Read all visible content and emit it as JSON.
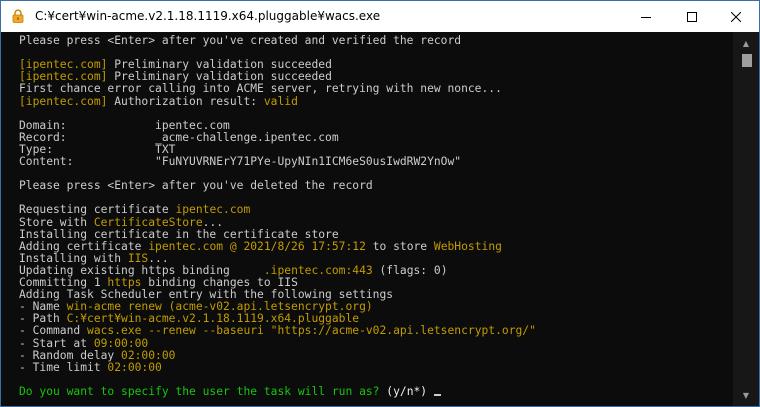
{
  "window": {
    "title": "C:¥cert¥win-acme.v2.1.18.1119.x64.pluggable¥wacs.exe",
    "icon": "lock-icon",
    "buttons": {
      "minimize": "minimize-icon",
      "maximize": "maximize-icon",
      "close": "close-icon"
    }
  },
  "colors": {
    "default": "#cccccc",
    "highlight": "#c19c00",
    "value": "#16c60c",
    "background": "#0c0c0c"
  },
  "console": {
    "lines": [
      [
        {
          "t": "Please press <Enter> after you've created and verified the record",
          "c": "def"
        }
      ],
      [],
      [
        {
          "t": "[ipentec.com]",
          "c": "yel"
        },
        {
          "t": " Preliminary validation succeeded",
          "c": "def"
        }
      ],
      [
        {
          "t": "[ipentec.com]",
          "c": "yel"
        },
        {
          "t": " Preliminary validation succeeded",
          "c": "def"
        }
      ],
      [
        {
          "t": "First chance error calling into ACME server, retrying with new nonce...",
          "c": "def"
        }
      ],
      [
        {
          "t": "[ipentec.com]",
          "c": "yel"
        },
        {
          "t": " Authorization result: ",
          "c": "def"
        },
        {
          "t": "valid",
          "c": "yel"
        }
      ],
      [],
      [
        {
          "t": "Domain:             ipentec.com",
          "c": "def"
        }
      ],
      [
        {
          "t": "Record:             _acme-challenge.ipentec.com",
          "c": "def"
        }
      ],
      [
        {
          "t": "Type:               TXT",
          "c": "def"
        }
      ],
      [
        {
          "t": "Content:            \"FuNYUVRNErY71PYe-UpyNIn1ICM6eS0usIwdRW2YnOw\"",
          "c": "def"
        }
      ],
      [],
      [
        {
          "t": "Please press <Enter> after you've deleted the record",
          "c": "def"
        }
      ],
      [],
      [
        {
          "t": "Requesting certificate ",
          "c": "def"
        },
        {
          "t": "ipentec.com",
          "c": "yel"
        }
      ],
      [
        {
          "t": "Store with ",
          "c": "def"
        },
        {
          "t": "CertificateStore",
          "c": "yel"
        },
        {
          "t": "...",
          "c": "def"
        }
      ],
      [
        {
          "t": "Installing certificate in the certificate store",
          "c": "def"
        }
      ],
      [
        {
          "t": "Adding certificate ",
          "c": "def"
        },
        {
          "t": "ipentec.com @ 2021/8/26 17:57:12",
          "c": "yel"
        },
        {
          "t": " to store ",
          "c": "def"
        },
        {
          "t": "WebHosting",
          "c": "yel"
        }
      ],
      [
        {
          "t": "Installing with ",
          "c": "def"
        },
        {
          "t": "IIS",
          "c": "yel"
        },
        {
          "t": "...",
          "c": "def"
        }
      ],
      [
        {
          "t": "Updating existing https binding     ",
          "c": "def"
        },
        {
          "t": ".ipentec.com:443",
          "c": "yel"
        },
        {
          "t": " (flags: 0)",
          "c": "def"
        }
      ],
      [
        {
          "t": "Committing 1 ",
          "c": "def"
        },
        {
          "t": "https",
          "c": "yel"
        },
        {
          "t": " binding changes to IIS",
          "c": "def"
        }
      ],
      [
        {
          "t": "Adding Task Scheduler entry with the following settings",
          "c": "def"
        }
      ],
      [
        {
          "t": "- Name ",
          "c": "def"
        },
        {
          "t": "win-acme renew (acme-v02.api.letsencrypt.org)",
          "c": "yel"
        }
      ],
      [
        {
          "t": "- Path ",
          "c": "def"
        },
        {
          "t": "C:¥cert¥win-acme.v2.1.18.1119.x64.pluggable",
          "c": "yel"
        }
      ],
      [
        {
          "t": "- Command ",
          "c": "def"
        },
        {
          "t": "wacs.exe --renew --baseuri \"https://acme-v02.api.letsencrypt.org/\"",
          "c": "yel"
        }
      ],
      [
        {
          "t": "- Start at ",
          "c": "def"
        },
        {
          "t": "09:00:00",
          "c": "yel"
        }
      ],
      [
        {
          "t": "- Random delay ",
          "c": "def"
        },
        {
          "t": "02:00:00",
          "c": "yel"
        }
      ],
      [
        {
          "t": "- Time limit ",
          "c": "def"
        },
        {
          "t": "02:00:00",
          "c": "yel"
        }
      ],
      [],
      [
        {
          "t": "Do you want to specify the user the task will run as?",
          "c": "grn"
        },
        {
          "t": " (y/n*) ",
          "c": "wht"
        }
      ]
    ]
  }
}
